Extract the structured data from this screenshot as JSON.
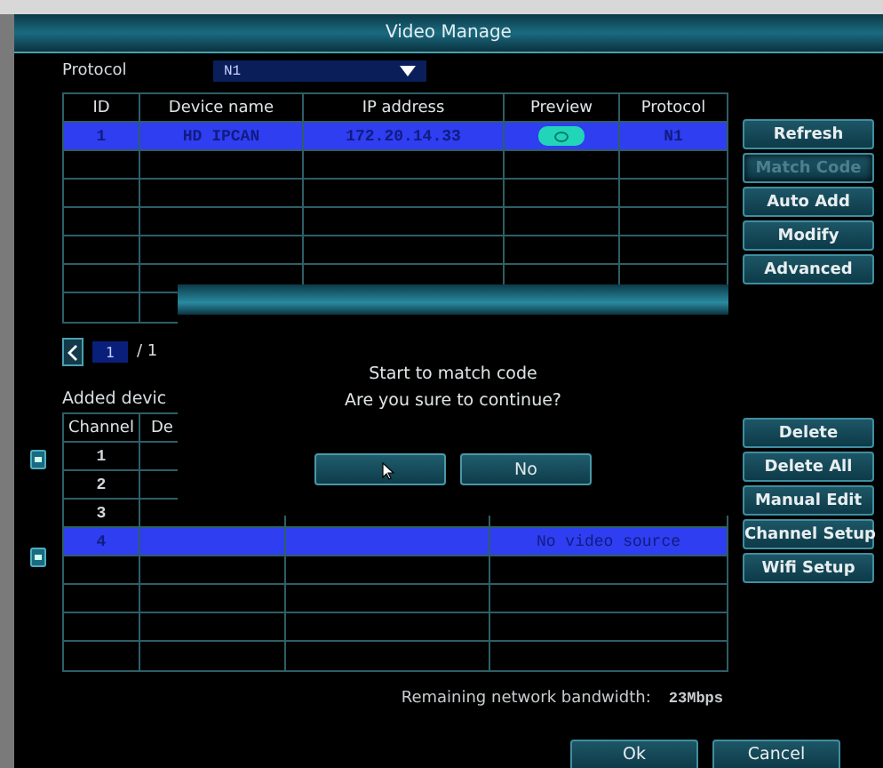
{
  "window": {
    "title": "Video Manage"
  },
  "protocol": {
    "label": "Protocol",
    "value": "N1"
  },
  "device_table": {
    "columns": [
      "ID",
      "Device name",
      "IP address",
      "Preview",
      "Protocol"
    ],
    "rows": [
      {
        "id": "1",
        "name": "HD IPCAN",
        "ip": "172.20.14.33",
        "protocol": "N1",
        "selected": true
      }
    ]
  },
  "pager": {
    "page": "1",
    "total": "/ 1"
  },
  "side_buttons": [
    {
      "label": "Refresh",
      "pressed": false
    },
    {
      "label": "Match Code",
      "pressed": true
    },
    {
      "label": "Auto Add",
      "pressed": false
    },
    {
      "label": "Modify",
      "pressed": false
    },
    {
      "label": "Advanced",
      "pressed": false
    }
  ],
  "added_devices": {
    "title": "Added devic",
    "columns": [
      "Channel",
      "De"
    ],
    "rows": [
      {
        "channel": "1",
        "selected": false
      },
      {
        "channel": "2",
        "selected": false
      },
      {
        "channel": "3",
        "selected": false
      },
      {
        "channel": "4",
        "status": "No video source",
        "selected": true
      }
    ]
  },
  "channel_buttons": [
    "Delete",
    "Delete All",
    "Manual Edit",
    "Channel Setup",
    "Wifi Setup"
  ],
  "bandwidth": {
    "label": "Remaining network bandwidth:",
    "value": "23Mbps"
  },
  "footer_buttons": [
    "Ok",
    "Cancel"
  ],
  "dialog": {
    "lines": [
      "Start to match code",
      "Are you sure to continue?"
    ],
    "confirm_button": {
      "hovered": true
    },
    "cancel_button": {
      "label": "No"
    }
  }
}
